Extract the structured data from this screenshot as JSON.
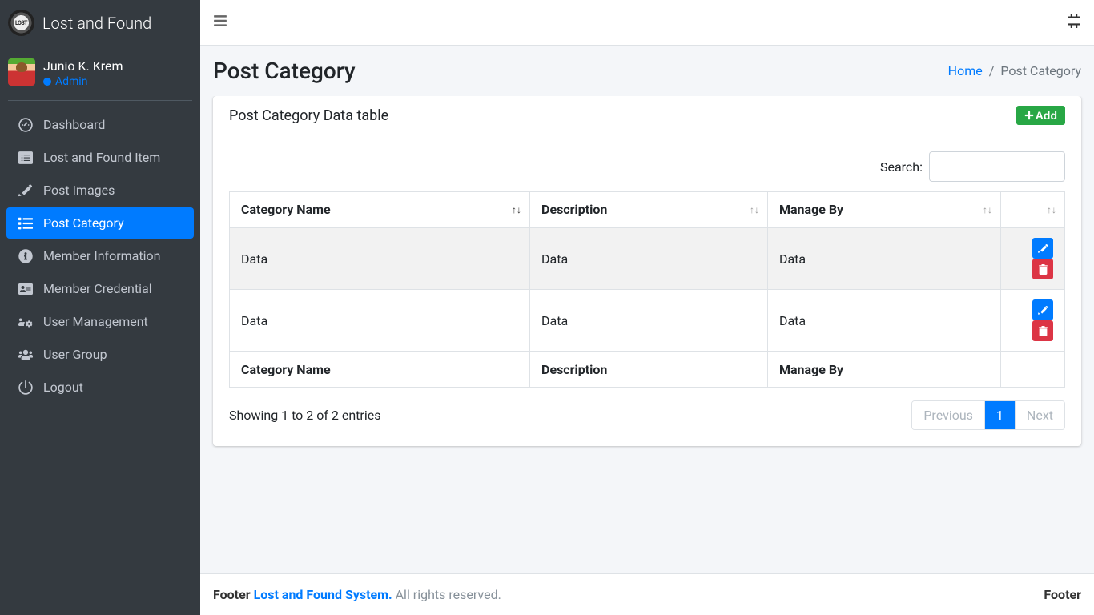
{
  "brand": {
    "text": "Lost and Found"
  },
  "user": {
    "name": "Junio K. Krem",
    "role": "Admin"
  },
  "sidebar": {
    "items": [
      {
        "label": "Dashboard"
      },
      {
        "label": "Lost and Found Item"
      },
      {
        "label": "Post Images"
      },
      {
        "label": "Post Category"
      },
      {
        "label": "Member Information"
      },
      {
        "label": "Member Credential"
      },
      {
        "label": "User Management"
      },
      {
        "label": "User Group"
      },
      {
        "label": "Logout"
      }
    ]
  },
  "header": {
    "title": "Post Category",
    "breadcrumb": {
      "home": "Home",
      "current": "Post Category"
    }
  },
  "card": {
    "title": "Post Category Data table",
    "add_label": "Add",
    "search_label": "Search:"
  },
  "table": {
    "columns": {
      "c1": "Category Name",
      "c2": "Description",
      "c3": "Manage By"
    },
    "rows": [
      {
        "c1": "Data",
        "c2": "Data",
        "c3": "Data"
      },
      {
        "c1": "Data",
        "c2": "Data",
        "c3": "Data"
      }
    ],
    "info": "Showing 1 to 2 of 2 entries"
  },
  "pagination": {
    "prev": "Previous",
    "page": "1",
    "next": "Next"
  },
  "footer": {
    "left_prefix": "Footer ",
    "left_link": "Lost and Found System.",
    "left_suffix": " All rights reserved.",
    "right": "Footer"
  }
}
